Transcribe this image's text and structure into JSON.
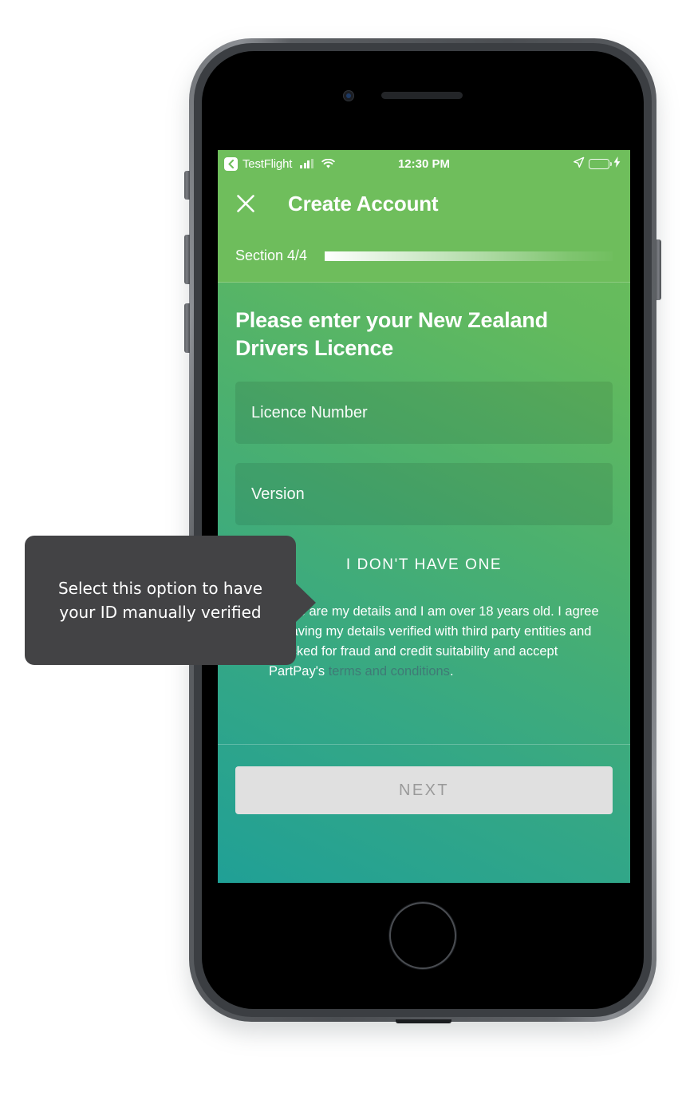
{
  "status_bar": {
    "back_label": "TestFlight",
    "time": "12:30 PM",
    "signal_icon": "cellular-bars-icon",
    "wifi_icon": "wifi-icon",
    "location_icon": "location-arrow-icon",
    "battery_icon": "battery-icon",
    "charging_icon": "lightning-bolt-icon"
  },
  "nav": {
    "close_icon": "close-x-icon",
    "title": "Create Account"
  },
  "progress": {
    "label": "Section 4/4",
    "current": 4,
    "total": 4
  },
  "form": {
    "heading": "Please enter your New Zealand Drivers Licence",
    "fields": [
      {
        "name": "licence-number",
        "placeholder": "Licence Number",
        "value": ""
      },
      {
        "name": "version",
        "placeholder": "Version",
        "value": ""
      }
    ],
    "no_licence_label": "I DON'T HAVE ONE",
    "consent": {
      "checked": false,
      "text_before": "These are my details and I am over 18 years old. I agree to having my details verified with third party entities and checked for fraud and credit suitability and accept PartPay's ",
      "link_text": "terms and conditions",
      "text_after": "."
    }
  },
  "footer": {
    "next_label": "NEXT",
    "next_enabled": false
  },
  "tooltip": {
    "text": "Select this option to have your ID manually verified"
  },
  "colors": {
    "screen_top": "#6fbe5c",
    "screen_bottom": "#20a096",
    "tooltip_bg": "#434345",
    "next_bg": "#e0e0e0",
    "next_text": "#9a9a9a",
    "link": "#3f7a76",
    "device_body": "#4c4f53"
  }
}
